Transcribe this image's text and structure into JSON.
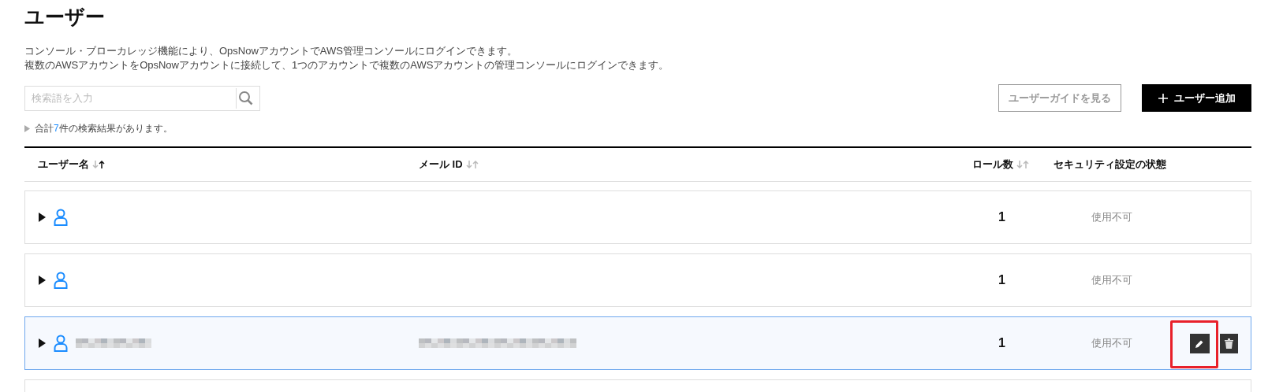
{
  "page": {
    "title": "ユーザー",
    "description": [
      "コンソール・ブローカレッジ機能により、OpsNowアカウントでAWS管理コンソールにログインできます。",
      "複数のAWSアカウントをOpsNowアカウントに接続して、1つのアカウントで複数のAWSアカウントの管理コンソールにログインできます。"
    ]
  },
  "search": {
    "placeholder": "検索語を入力"
  },
  "result_summary": {
    "prefix": "合計",
    "count": "7",
    "suffix": "件の検索結果があります。"
  },
  "buttons": [
    {
      "label": "ユーザーガイドを見る",
      "kind": "outline"
    },
    {
      "label": "ユーザー追加",
      "kind": "primary"
    }
  ],
  "table": {
    "columns": [
      {
        "label": "ユーザー名",
        "sortable": true,
        "sorted_ascending": true
      },
      {
        "label": "メール ID",
        "sortable": true,
        "sorted_ascending": false
      },
      {
        "label": "ロール数",
        "sortable": true,
        "sorted_ascending": false
      },
      {
        "label": "セキュリティ設定の状態"
      }
    ],
    "rows": [
      {
        "expanded": false,
        "selected": false,
        "redacted": false,
        "role_count": "1",
        "security_status": "使用不可",
        "actions_visible": false,
        "edit_highlighted": false
      },
      {
        "expanded": false,
        "selected": false,
        "redacted": false,
        "role_count": "1",
        "security_status": "使用不可",
        "actions_visible": false,
        "edit_highlighted": false
      },
      {
        "expanded": false,
        "selected": true,
        "redacted": true,
        "role_count": "1",
        "security_status": "使用不可",
        "actions_visible": true,
        "edit_highlighted": true
      }
    ],
    "more_rows_below": true
  }
}
